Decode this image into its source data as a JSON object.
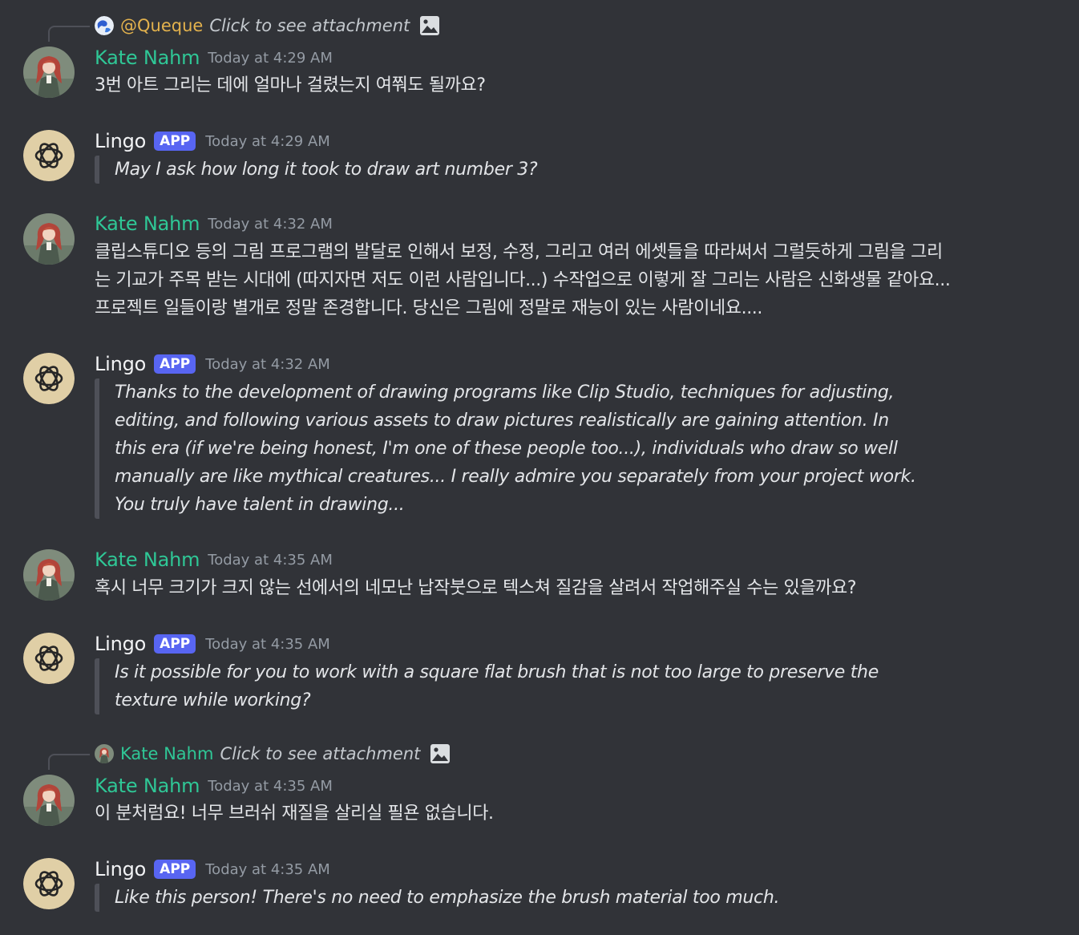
{
  "messages": {
    "m1": {
      "reply_to": {
        "name": "@Queque",
        "text": "Click to see attachment",
        "name_color": "#e3b24d"
      },
      "author": "Kate Nahm",
      "time": "Today at 4:29 AM",
      "lines": [
        "3번 아트 그리는 데에 얼마나 걸렸는지 여쭤도 될까요?"
      ]
    },
    "m2": {
      "author": "Lingo",
      "badge": "APP",
      "time": "Today at 4:29 AM",
      "lines": [
        "May I ask how long it took to draw art number 3?"
      ]
    },
    "m3": {
      "author": "Kate Nahm",
      "time": "Today at 4:32 AM",
      "lines": [
        "클립스튜디오 등의 그림 프로그램의 발달로 인해서 보정, 수정, 그리고 여러 에셋들을 따라써서 그럴듯하게 그림을 그리",
        "는 기교가 주목 받는 시대에 (따지자면 저도 이런 사람입니다...) 수작업으로 이렇게 잘 그리는 사람은 신화생물 같아요...",
        "프로젝트 일들이랑 별개로 정말 존경합니다. 당신은 그림에 정말로 재능이 있는 사람이네요...."
      ]
    },
    "m4": {
      "author": "Lingo",
      "badge": "APP",
      "time": "Today at 4:32 AM",
      "lines": [
        "Thanks to the development of drawing programs like Clip Studio, techniques for adjusting,",
        "editing, and following various assets to draw pictures realistically are gaining attention. In",
        "this era (if we're being honest, I'm one of these people too...), individuals who draw so well",
        "manually are like mythical creatures... I really admire you separately from your project work.",
        "You truly have talent in drawing..."
      ]
    },
    "m5": {
      "author": "Kate Nahm",
      "time": "Today at 4:35 AM",
      "lines": [
        "혹시 너무 크기가 크지 않는 선에서의 네모난 납작붓으로 텍스쳐 질감을 살려서 작업해주실 수는 있을까요?"
      ]
    },
    "m6": {
      "author": "Lingo",
      "badge": "APP",
      "time": "Today at 4:35 AM",
      "lines": [
        "Is it possible for you to work with a square flat brush that is not too large to preserve the",
        "texture while working?"
      ]
    },
    "m7": {
      "reply_to": {
        "name": "Kate Nahm",
        "text": "Click to see attachment",
        "name_color": "#2fc796"
      },
      "author": "Kate Nahm",
      "time": "Today at 4:35 AM",
      "lines": [
        "이 분처럼요! 너무 브러쉬 재질을 살리실 필욘 없습니다."
      ]
    },
    "m8": {
      "author": "Lingo",
      "badge": "APP",
      "time": "Today at 4:35 AM",
      "lines": [
        "Like this person! There's no need to emphasize the brush material too much."
      ]
    }
  },
  "colors": {
    "background": "#313338",
    "kate_name": "#2fc796",
    "queque_name": "#e3b24d",
    "app_badge": "#5865f2",
    "timestamp": "#949ba4",
    "quote_bar": "#4e5058",
    "lingo_avatar_bg": "#e0cfa6"
  },
  "icons": {
    "kate_avatar": "anime-girl-avatar",
    "lingo_avatar": "openai-logo-icon",
    "queque_avatar": "earth-avatar",
    "attachment": "image-icon"
  }
}
